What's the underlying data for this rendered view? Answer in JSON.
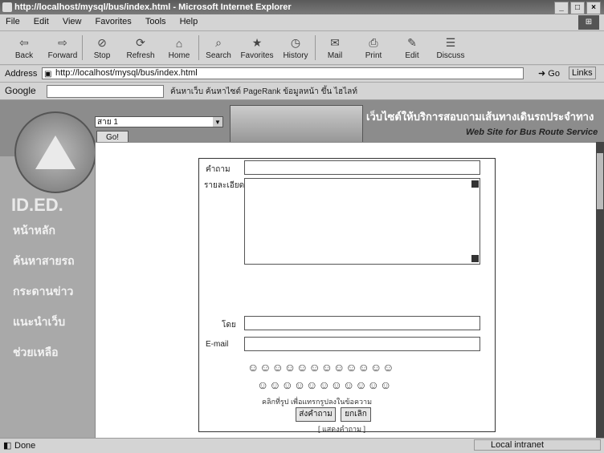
{
  "window": {
    "title": "http://localhost/mysql/bus/index.html - Microsoft Internet Explorer",
    "controls": [
      "_",
      "□",
      "×"
    ]
  },
  "menu": [
    "File",
    "Edit",
    "View",
    "Favorites",
    "Tools",
    "Help"
  ],
  "toolbar": [
    {
      "label": "Back",
      "icon": "back-arrow-icon"
    },
    {
      "label": "Forward",
      "icon": "forward-arrow-icon"
    },
    {
      "label": "Stop",
      "icon": "stop-icon"
    },
    {
      "label": "Refresh",
      "icon": "refresh-icon"
    },
    {
      "label": "Home",
      "icon": "home-icon"
    },
    {
      "label": "Search",
      "icon": "search-icon"
    },
    {
      "label": "Favorites",
      "icon": "favorites-icon"
    },
    {
      "label": "History",
      "icon": "history-icon"
    },
    {
      "label": "Mail",
      "icon": "mail-icon"
    },
    {
      "label": "Print",
      "icon": "print-icon"
    },
    {
      "label": "Edit",
      "icon": "edit-icon"
    },
    {
      "label": "Discuss",
      "icon": "discuss-icon"
    }
  ],
  "address": {
    "label": "Address",
    "url": "http://localhost/mysql/bus/index.html",
    "go": "Go",
    "links": "Links"
  },
  "google": {
    "logo": "Google",
    "tools": "ค้นหาเว็บ  ค้นหาไซต์  PageRank  ข้อมูลหน้า  ขึ้น  ไฮไลท์"
  },
  "site": {
    "route_select": "สาย 1",
    "go_button": "Go!",
    "banner_thai": "เว็บไซต์ให้บริการสอบถามเส้นทางเดินรถประจำทาง",
    "banner_en": "Web Site for Bus Route Service",
    "logo_text": "ID.ED.",
    "nav": [
      "หน้าหลัก",
      "ค้นหาสายรถ",
      "กระดานข่าว",
      "แนะนำเว็บ",
      "ช่วยเหลือ"
    ]
  },
  "form": {
    "question_label": "คำถาม",
    "detail_label": "รายละเอียด",
    "by_label": "โดย",
    "email_label": "E-mail",
    "emoticons_row1": "☺☺☺☺☺☺☺☺☺☺☺☺",
    "emoticons_row2": "☺☺☺☺☺☺☺☺☺☺☺",
    "emoticon_hint": "คลิกที่รูป เพื่อแทรกรูปลงในข้อความ",
    "submit": "ส่งคำถาม",
    "cancel": "ยกเลิก",
    "show_questions": "[ แสดงคำถาม ]"
  },
  "status": {
    "text": "Done",
    "zone": "Local intranet"
  }
}
